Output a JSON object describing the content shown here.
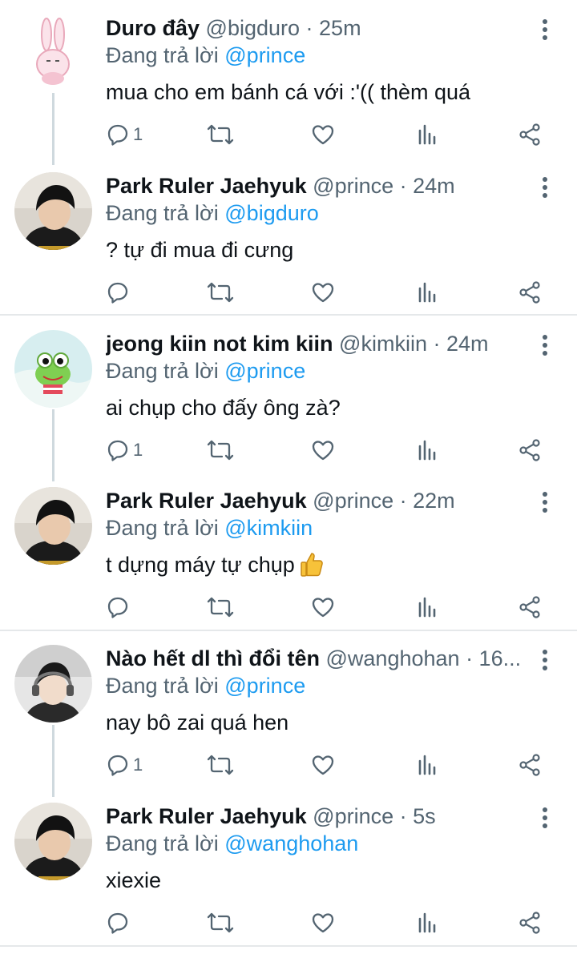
{
  "reply_prefix": "Đang trả lời ",
  "tweets": [
    {
      "name": "Duro đây",
      "handle": "@bigduro",
      "time": "· 25m",
      "reply_to": "@prince",
      "text": "mua cho em bánh cá với :'(( thèm quá",
      "reply_count": "1"
    },
    {
      "name": "Park Ruler Jaehyuk",
      "handle": "@prince",
      "time": "· 24m",
      "reply_to": "@bigduro",
      "text": "? tự đi mua đi cưng",
      "reply_count": ""
    },
    {
      "name": "jeong kiin not kim kiin",
      "handle": "@kimkiin",
      "time": "· 24m",
      "reply_to": "@prince",
      "text": "ai chụp cho đấy ông zà?",
      "reply_count": "1"
    },
    {
      "name": "Park Ruler Jaehyuk",
      "handle": "@prince",
      "time": "· 22m",
      "reply_to": "@kimkiin",
      "text": "t dựng máy tự chụp",
      "reply_count": ""
    },
    {
      "name": "Nào hết dl thì đổi tên",
      "handle": "@wanghohan",
      "time": "· 16...",
      "reply_to": "@prince",
      "text": "nay bô zai quá hen",
      "reply_count": "1"
    },
    {
      "name": "Park Ruler Jaehyuk",
      "handle": "@prince",
      "time": "· 5s",
      "reply_to": "@wanghohan",
      "text": "xiexie",
      "reply_count": ""
    }
  ],
  "icons": {
    "reply": "reply-icon",
    "retweet": "retweet-icon",
    "like": "heart-icon",
    "views": "analytics-icon",
    "share": "share-icon",
    "more": "more-icon",
    "emoji": "thumbs-up-emoji"
  },
  "colors": {
    "text": "#0f1419",
    "secondary": "#536471",
    "accent": "#1d9bf0",
    "separator": "#e5e8ea"
  }
}
